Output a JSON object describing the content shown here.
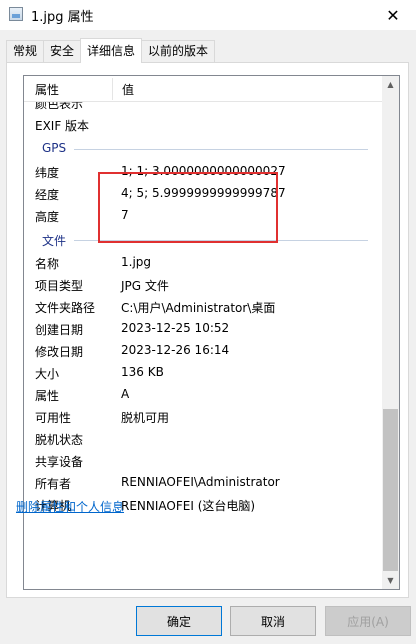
{
  "window": {
    "title": "1.jpg 属性",
    "close_glyph": "✕"
  },
  "tabs": [
    {
      "label": "常规"
    },
    {
      "label": "安全"
    },
    {
      "label": "详细信息"
    },
    {
      "label": "以前的版本"
    }
  ],
  "header": {
    "col1": "属性",
    "col2": "值"
  },
  "partial_row": {
    "key": "颜色表示"
  },
  "rows_top": [
    {
      "key": "EXIF 版本",
      "value": ""
    }
  ],
  "groups": {
    "gps": "GPS",
    "file": "文件"
  },
  "gps_rows": [
    {
      "key": "纬度",
      "value": "1; 1; 3.0000000000000027"
    },
    {
      "key": "经度",
      "value": "4; 5; 5.9999999999999787"
    },
    {
      "key": "高度",
      "value": "7"
    }
  ],
  "file_rows": [
    {
      "key": "名称",
      "value": "1.jpg"
    },
    {
      "key": "项目类型",
      "value": "JPG 文件"
    },
    {
      "key": "文件夹路径",
      "value": "C:\\用户\\Administrator\\桌面"
    },
    {
      "key": "创建日期",
      "value": "2023-12-25 10:52"
    },
    {
      "key": "修改日期",
      "value": "2023-12-26 16:14"
    },
    {
      "key": "大小",
      "value": "136 KB"
    },
    {
      "key": "属性",
      "value": "A"
    },
    {
      "key": "可用性",
      "value": "脱机可用"
    },
    {
      "key": "脱机状态",
      "value": ""
    },
    {
      "key": "共享设备",
      "value": ""
    },
    {
      "key": "所有者",
      "value": "RENNIAOFEI\\Administrator"
    },
    {
      "key": "计算机",
      "value": "RENNIAOFEI (这台电脑)"
    }
  ],
  "scroll": {
    "up": "▲",
    "down": "▼"
  },
  "link": "删除属性和个人信息",
  "buttons": {
    "ok": "确定",
    "cancel": "取消",
    "apply": "应用(A)"
  },
  "colors": {
    "highlight": "#e03030",
    "link": "#0066cc",
    "group": "#1e3287"
  }
}
